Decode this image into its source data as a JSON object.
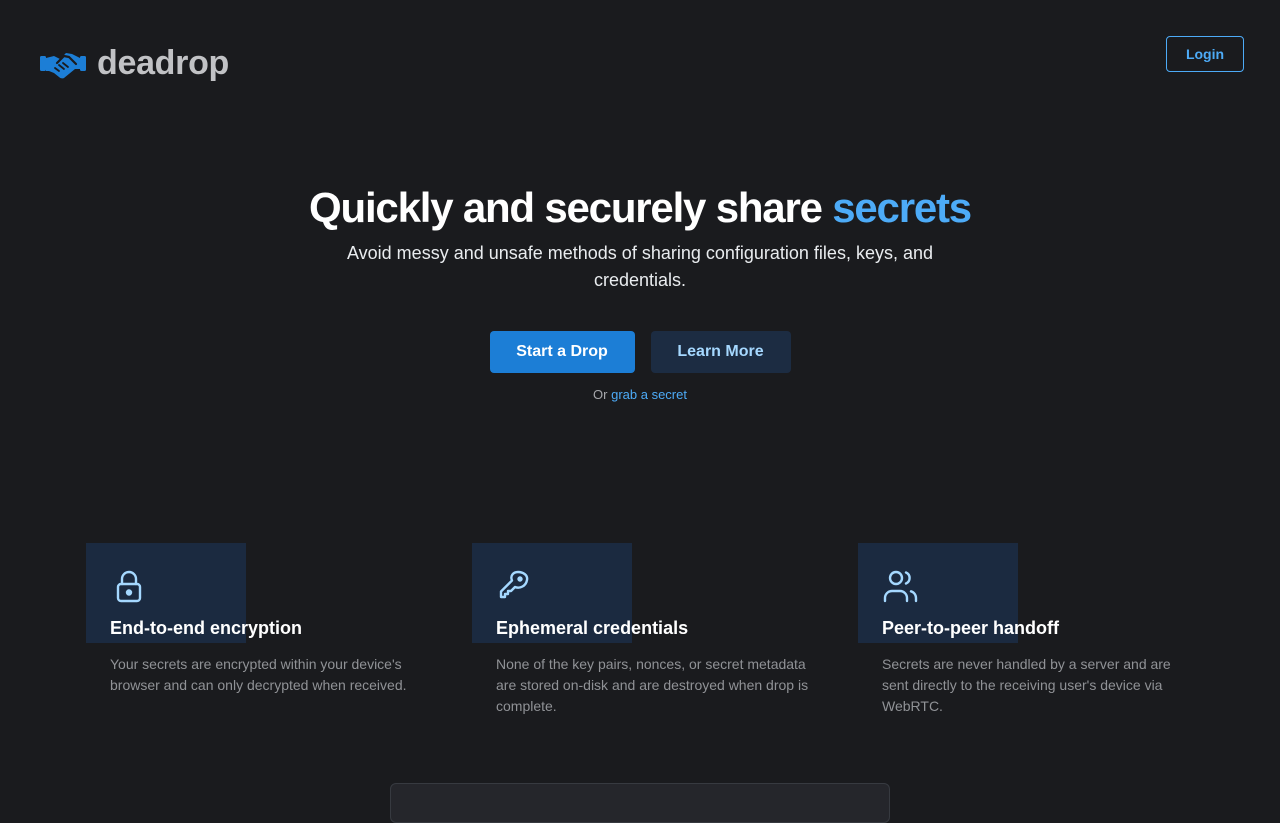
{
  "brand": {
    "name": "deadrop",
    "icon": "handshake-icon",
    "icon_color": "#1c7ed6"
  },
  "header": {
    "login_label": "Login"
  },
  "hero": {
    "title_main": "Quickly and securely share ",
    "title_accent": "secrets",
    "subtitle": "Avoid messy and unsafe methods of sharing configuration files, keys, and credentials.",
    "primary_cta": "Start a Drop",
    "secondary_cta": "Learn More",
    "grab_prefix": "Or",
    "grab_link": "grab a secret"
  },
  "features": [
    {
      "icon": "lock-icon",
      "title": "End-to-end encryption",
      "description": "Your secrets are encrypted within your device's browser and can only decrypted when received."
    },
    {
      "icon": "key-icon",
      "title": "Ephemeral credentials",
      "description": "None of the key pairs, nonces, or secret metadata are stored on-disk and are destroyed when drop is complete."
    },
    {
      "icon": "users-icon",
      "title": "Peer-to-peer handoff",
      "description": "Secrets are never handled by a server and are sent directly to the receiving user's device via WebRTC."
    }
  ],
  "colors": {
    "background": "#1a1b1e",
    "accent": "#4dabf7",
    "primary": "#1c7ed6",
    "feature_tile": "#1b2a40",
    "muted_text": "#909296"
  }
}
